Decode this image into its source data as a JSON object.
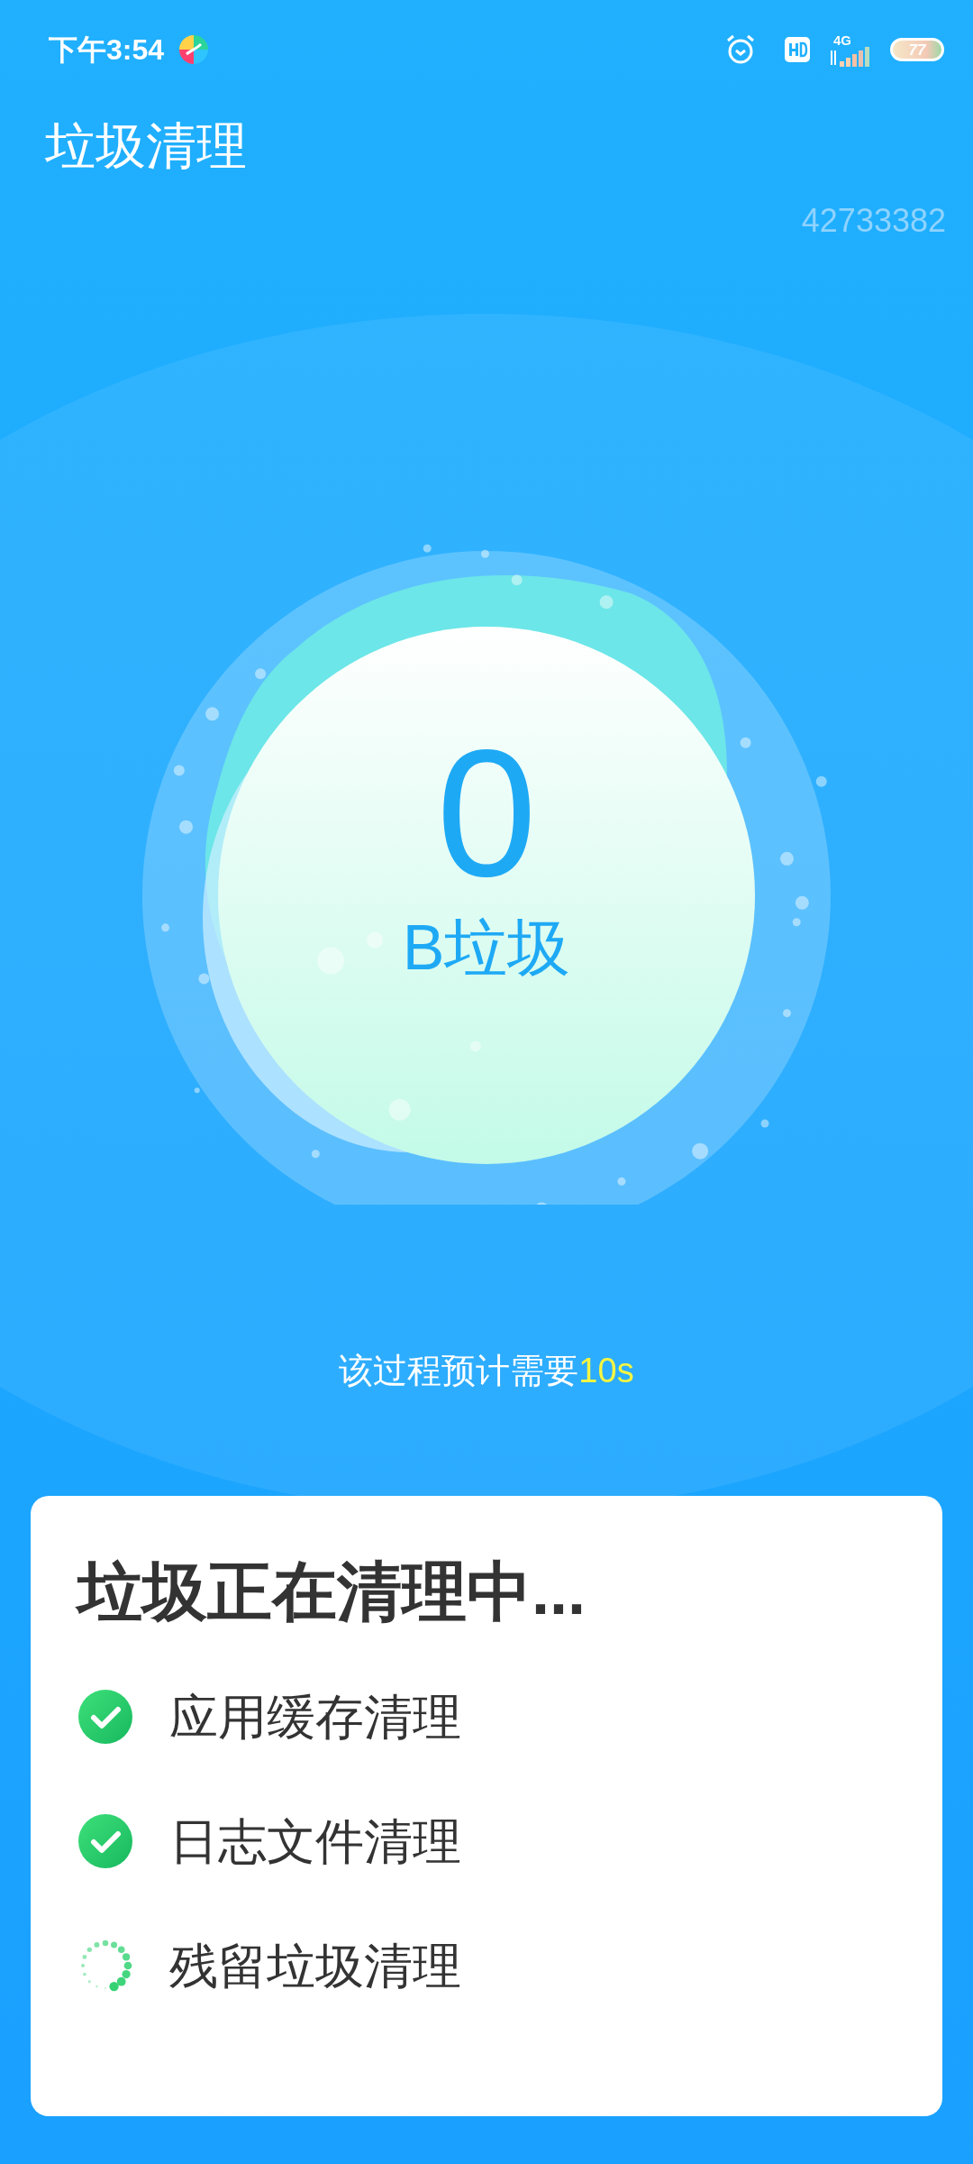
{
  "status_bar": {
    "time": "下午3:54",
    "network": "4G",
    "battery": "77"
  },
  "title": "垃圾清理",
  "counter": "42733382",
  "cleaner": {
    "amount": "0",
    "unit": "B垃圾"
  },
  "estimate": {
    "text": "该过程预计需要",
    "highlight": "10s"
  },
  "card": {
    "title": "垃圾正在清理中...",
    "tasks": [
      {
        "label": "应用缓存清理",
        "done": true
      },
      {
        "label": "日志文件清理",
        "done": true
      },
      {
        "label": "残留垃圾清理",
        "done": false
      }
    ]
  }
}
